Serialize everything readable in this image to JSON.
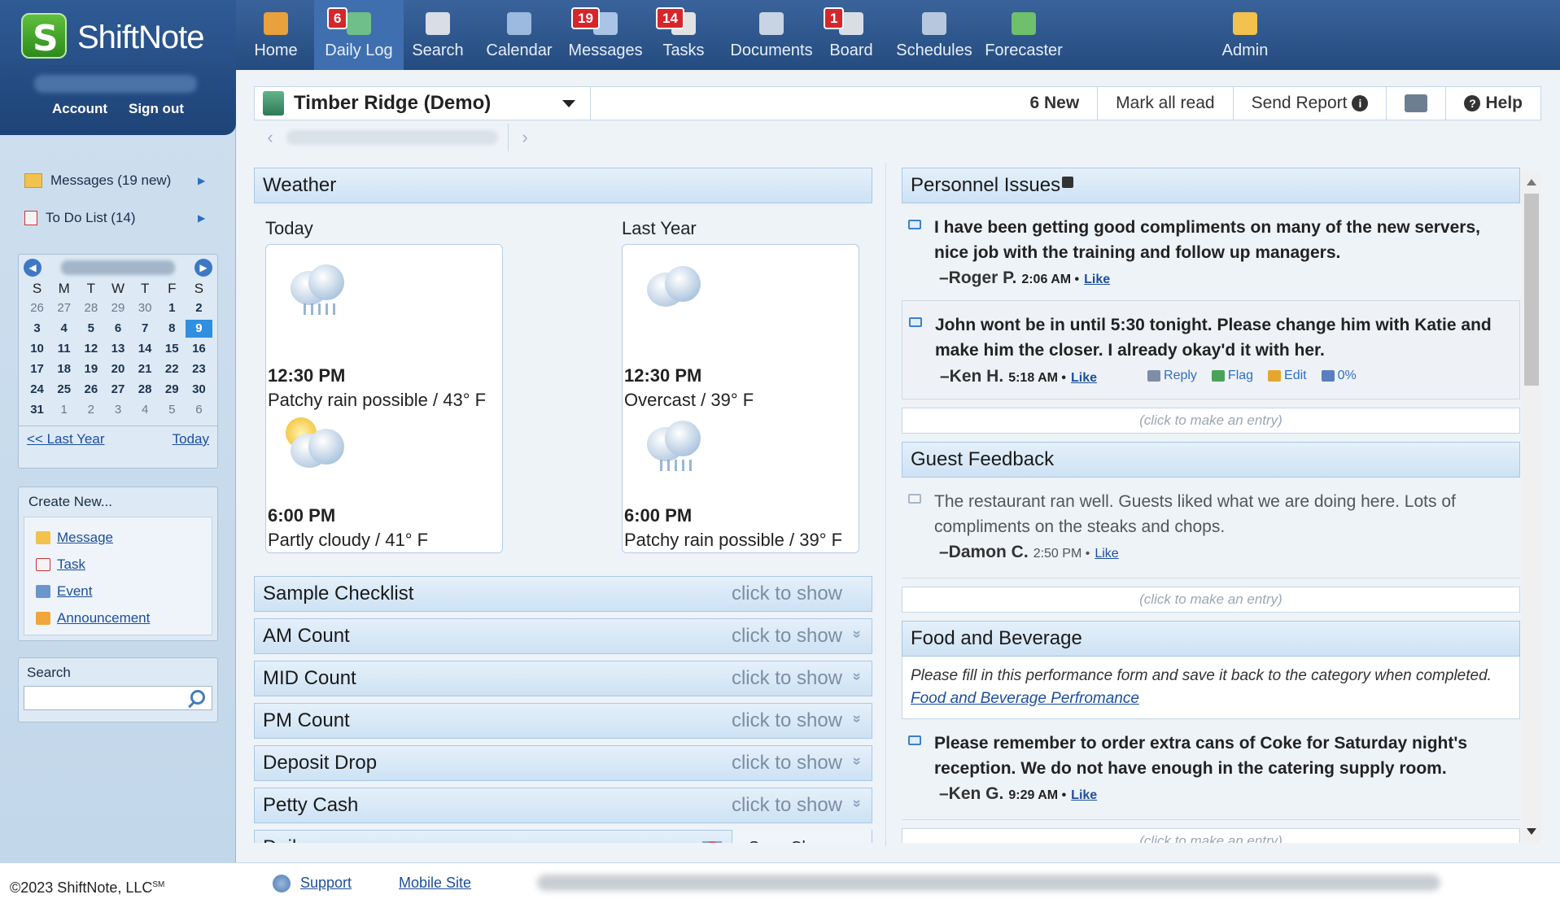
{
  "brand": {
    "name": "ShiftNote",
    "account_label": "Account",
    "signout_label": "Sign out"
  },
  "nav": [
    {
      "label": "Home",
      "icon": "home-icon",
      "badge": null
    },
    {
      "label": "Daily Log",
      "icon": "daily-log-icon",
      "badge": "6"
    },
    {
      "label": "Search",
      "icon": "search-icon",
      "badge": null
    },
    {
      "label": "Calendar",
      "icon": "calendar-icon",
      "badge": null
    },
    {
      "label": "Messages",
      "icon": "messages-icon",
      "badge": "19"
    },
    {
      "label": "Tasks",
      "icon": "tasks-icon",
      "badge": "14"
    },
    {
      "label": "Documents",
      "icon": "documents-icon",
      "badge": null
    },
    {
      "label": "Board",
      "icon": "board-icon",
      "badge": "1"
    },
    {
      "label": "Schedules",
      "icon": "schedules-icon",
      "badge": null
    },
    {
      "label": "Forecaster",
      "icon": "forecaster-icon",
      "badge": null
    },
    {
      "label": "Admin",
      "icon": "admin-icon",
      "badge": null
    }
  ],
  "sidebar": {
    "messages": "Messages (19 new)",
    "todo": "To Do List (14)",
    "calendar": {
      "dows": [
        "S",
        "M",
        "T",
        "W",
        "T",
        "F",
        "S"
      ],
      "days": [
        [
          "26",
          "27",
          "28",
          "29",
          "30",
          "1",
          "2"
        ],
        [
          "3",
          "4",
          "5",
          "6",
          "7",
          "8",
          "9"
        ],
        [
          "10",
          "11",
          "12",
          "13",
          "14",
          "15",
          "16"
        ],
        [
          "17",
          "18",
          "19",
          "20",
          "21",
          "22",
          "23"
        ],
        [
          "24",
          "25",
          "26",
          "27",
          "28",
          "29",
          "30"
        ],
        [
          "31",
          "1",
          "2",
          "3",
          "4",
          "5",
          "6"
        ]
      ],
      "selected_day": "9",
      "last_year": "<< Last Year",
      "today": "Today"
    },
    "create_new": {
      "title": "Create New...",
      "items": [
        "Message",
        "Task",
        "Event",
        "Announcement"
      ]
    },
    "search_label": "Search"
  },
  "header": {
    "location": "Timber Ridge (Demo)",
    "new_count": "6 New",
    "mark_all_read": "Mark all read",
    "send_report": "Send Report",
    "help": "Help"
  },
  "weather": {
    "title": "Weather",
    "today_label": "Today",
    "last_year_label": "Last Year",
    "today": [
      {
        "time": "12:30 PM",
        "desc": "Patchy rain possible / 43° F",
        "icon": "rain-cloud-icon"
      },
      {
        "time": "6:00 PM",
        "desc": "Partly cloudy / 41° F",
        "icon": "partly-cloudy-icon"
      }
    ],
    "last_year": [
      {
        "time": "12:30 PM",
        "desc": "Overcast / 39° F",
        "icon": "overcast-icon"
      },
      {
        "time": "6:00 PM",
        "desc": "Patchy rain possible / 39° F",
        "icon": "rain-cloud-icon"
      }
    ]
  },
  "sections": [
    {
      "title": "Sample Checklist",
      "show": "click to show",
      "chevron": false
    },
    {
      "title": "AM Count",
      "show": "click to show",
      "chevron": true
    },
    {
      "title": "MID Count",
      "show": "click to show",
      "chevron": true
    },
    {
      "title": "PM Count",
      "show": "click to show",
      "chevron": true
    },
    {
      "title": "Deposit Drop",
      "show": "click to show",
      "chevron": true
    },
    {
      "title": "Petty Cash",
      "show": "click to show",
      "chevron": true
    }
  ],
  "daily": {
    "title": "Daily",
    "save": "Save Changes"
  },
  "personnel": {
    "title": "Personnel Issues",
    "entries": [
      {
        "text": "I have been getting good compliments on many of the new servers, nice job with the training and follow up managers.",
        "author": "–Roger P.",
        "time": "2:06 AM •",
        "like": "Like"
      },
      {
        "text": "John wont be in until 5:30 tonight. Please change him with Katie and make him the closer. I already okay'd it with her.",
        "author": "–Ken H.",
        "time": "5:18 AM •",
        "like": "Like",
        "actions": {
          "reply": "Reply",
          "flag": "Flag",
          "edit": "Edit",
          "pct": "0%"
        }
      }
    ],
    "make_entry": "(click to make an entry)"
  },
  "guest": {
    "title": "Guest Feedback",
    "entry": {
      "text": "The restaurant ran well. Guests liked what we are doing here. Lots of compliments on the steaks and chops.",
      "author": "–Damon C.",
      "time": "2:50 PM •",
      "like": "Like"
    },
    "make_entry": "(click to make an entry)"
  },
  "food": {
    "title": "Food and Beverage",
    "note": "Please fill in this performance form and save it back to the category when completed.",
    "note_link": "Food and Beverage Perfromance",
    "entry": {
      "text": "Please remember to order extra cans of Coke for Saturday night's reception. We do not have enough in the catering supply room.",
      "author": "–Ken G.",
      "time": "9:29 AM •",
      "like": "Like"
    },
    "make_entry": "(click to make an entry)"
  },
  "footer": {
    "copyright": "©2023 ShiftNote, LLC",
    "sm": "SM",
    "support": "Support",
    "mobile": "Mobile Site"
  },
  "colors": {
    "nav_bg": "#244c80",
    "badge": "#d5262b",
    "link": "#1d4e9a",
    "section_head": "#cde2f4"
  }
}
